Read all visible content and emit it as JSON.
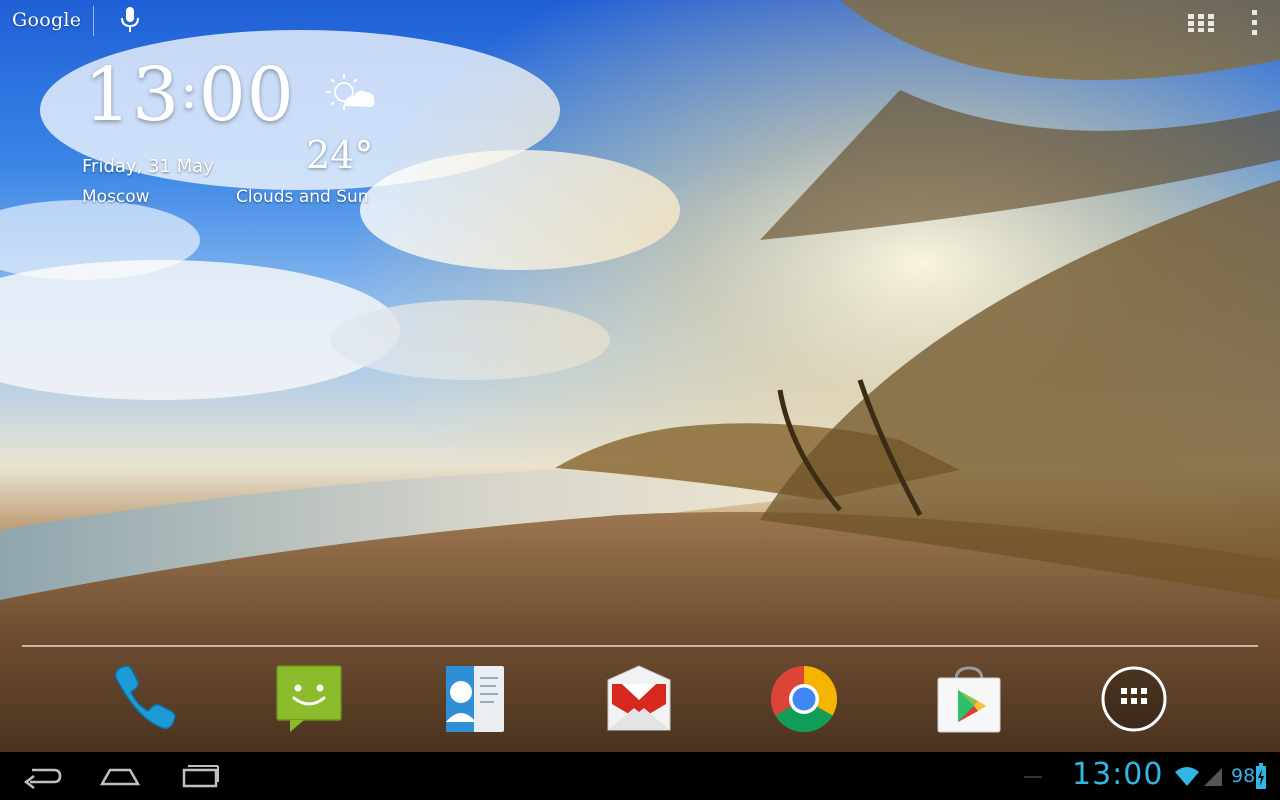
{
  "search": {
    "label": "Google",
    "mic_icon": "mic-icon"
  },
  "topbar": {
    "apps_icon": "apps-grid-icon",
    "menu_icon": "overflow-icon"
  },
  "clock": {
    "time_hours": "13",
    "time_sep": ":",
    "time_minutes": "00",
    "date": "Friday, 31 May",
    "city": "Moscow"
  },
  "weather": {
    "icon": "partly-cloudy-icon",
    "temperature": "24°",
    "condition": "Clouds and Sun"
  },
  "dock": {
    "apps": [
      {
        "name": "Phone",
        "icon": "phone-icon"
      },
      {
        "name": "Messaging",
        "icon": "messaging-icon"
      },
      {
        "name": "People",
        "icon": "contacts-icon"
      },
      {
        "name": "Gmail",
        "icon": "gmail-icon"
      },
      {
        "name": "Chrome",
        "icon": "chrome-icon"
      },
      {
        "name": "Play Store",
        "icon": "play-store-icon"
      },
      {
        "name": "All apps",
        "icon": "all-apps-icon"
      }
    ]
  },
  "navbar": {
    "back_icon": "back-icon",
    "home_icon": "home-icon",
    "recents_icon": "recents-icon",
    "time": "13:00",
    "battery": "98",
    "accent_color": "#33b5e5"
  }
}
